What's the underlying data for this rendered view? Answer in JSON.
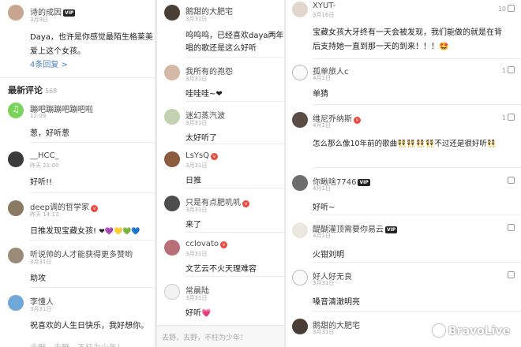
{
  "p1": {
    "top": {
      "name": "诗的成因",
      "time": "3月9日",
      "text1": "Daya，也许是你感觉最陌生格莱美",
      "text2": "爱上这个女孩。",
      "more": "4条回复 >"
    },
    "section": {
      "title": "最新评论",
      "count": "568"
    },
    "comments": [
      {
        "name": "蹦吧蹦蹦吧蹦吧啦",
        "time": "12:09",
        "text": "葱，好听葱"
      },
      {
        "name": "__HCC_",
        "time": "昨天 21:00",
        "text": "好听!!"
      },
      {
        "name": "deep调的哲学家",
        "time": "昨天 14:13",
        "text": "日推发现宝藏女孩!"
      },
      {
        "name": "听说帅的人才能获得更多赞哟",
        "time": "3月31日",
        "text": "助攻"
      },
      {
        "name": "李懂人",
        "time": "3月31日",
        "text": "祝喜欢的人生日快乐，我好想你。"
      }
    ],
    "hearts": "❤💜💛💚💙",
    "bottom": "去野，去野，不枉为少年！"
  },
  "p2": {
    "comments": [
      {
        "name": "鹅甜的大肥宅",
        "time": "3月31日",
        "text1": "呜呜呜，已经喜欢daya两年了",
        "text2": "唱的歌还是这么好听"
      },
      {
        "name": "我所有的孢怨",
        "time": "3月31日",
        "text": "哇哇哇~❤"
      },
      {
        "name": "迷幻蒸汽波",
        "time": "3月31日",
        "text": "太好听了"
      },
      {
        "name": "LsYsQ",
        "time": "3月31日",
        "text": "日推"
      },
      {
        "name": "只是有点肥叽叽",
        "time": "3月31日",
        "text": "来了"
      },
      {
        "name": "cclovato",
        "time": "3月31日",
        "text": "文艺云不火天理难容"
      },
      {
        "name": "常晨陆",
        "time": "3月31日",
        "text": "好听💗"
      }
    ],
    "bottom": "去野，去野，不枉为少年！"
  },
  "p3": {
    "comments": [
      {
        "name": "XYUT-",
        "time": "3月16日",
        "text1": "宝藏女孩大牙终有一天会被发现，我们能做的就是在背",
        "text2": "后支持她一直到那一天的到来！！！🤩",
        "likes": "10"
      },
      {
        "name": "孤单旅人c",
        "time": "4月1日",
        "text": "单猜",
        "likes": "1"
      },
      {
        "name": "维尼乔纳斯",
        "time": "4月1日",
        "text": "怎么那么像10年前的歌曲👯👯👯👯不过还是很好听👯",
        "likes": "1"
      },
      {
        "name": "你瞅啥7746",
        "time": "4月1日",
        "text": "好听~",
        "likes": ""
      },
      {
        "name": "醍醐灌顶需要你易云",
        "time": "4月1日",
        "text": "火钳刘明",
        "likes": ""
      },
      {
        "name": "好人好无良",
        "time": "3月31日",
        "text": "嗓音清澈明亮",
        "likes": ""
      },
      {
        "name": "鹅甜的大肥宅",
        "time": "3月31日",
        "text": "",
        "likes": ""
      }
    ],
    "watermark": "BravoLive"
  }
}
